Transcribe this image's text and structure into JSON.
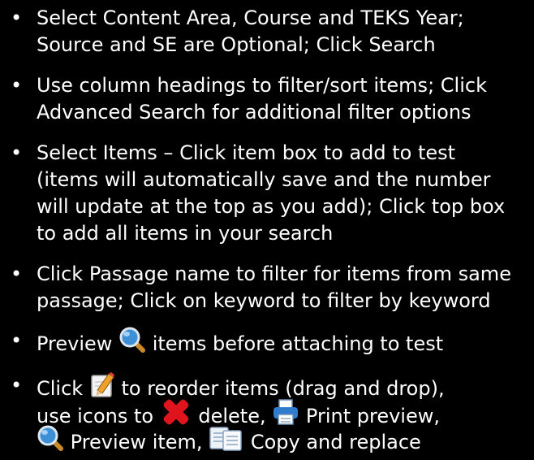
{
  "bullets": [
    {
      "lines": [
        "Select Content Area, Course and TEKS Year;",
        "Source and SE are Optional;  Click Search"
      ]
    },
    {
      "lines": [
        "Use column headings to filter/sort items; Click",
        "Advanced Search for additional filter options"
      ]
    },
    {
      "lines": [
        "Select Items – Click item box to add to test",
        "(items will automatically save and the number",
        "will update at the top as you add); Click top box",
        "to add all items in your search"
      ]
    },
    {
      "lines": [
        "Click Passage name to filter for items from same",
        "passage; Click on keyword to filter by keyword"
      ]
    },
    {
      "preview_prefix": "Preview",
      "preview_suffix": "items before attaching to test"
    },
    {
      "click_prefix": "Click",
      "click_suffix": "to reorder items (drag and drop),",
      "line2_prefix": "use icons to",
      "delete_label": "delete,",
      "print_label": "Print preview,",
      "preview_item_label": "Preview item,",
      "copy_label": "Copy and replace"
    }
  ],
  "icons": {
    "magnifier": "magnifier-icon",
    "edit": "edit-icon",
    "delete": "delete-icon",
    "print": "print-icon",
    "copy": "copy-icon"
  },
  "colors": {
    "background": "#000000",
    "text": "#ffffff",
    "delete_red": "#e0141c",
    "magnifier_blue": "#3d8fd6",
    "print_blue": "#2f7bd0"
  }
}
